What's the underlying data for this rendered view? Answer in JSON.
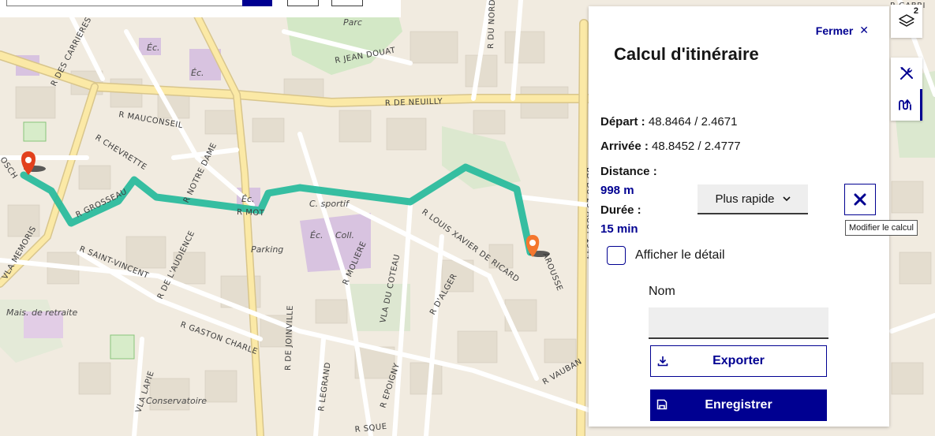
{
  "map": {
    "streets": [
      "R DES CARRIERES",
      "R JEAN DOUAT",
      "R DE NEUILLY",
      "R DU NORD",
      "R MAUCONSEIL",
      "R CHEVRETTE",
      "R NOTRE DAME",
      "R GROSSEAU",
      "R MOT",
      "R LOUIS XAVIER DE RICARD",
      "BD DU 25 AOUT 1944",
      "VLA MEMORIS",
      "R SAINT-VINCENT",
      "R DE L'AUDIENCE",
      "R MOLIERE",
      "VLA DU COTEAU",
      "R D'ALGER",
      "R GASTON CHARLE",
      "R DE JOINVILLE",
      "VLA LAPIE",
      "R LEGRAND",
      "R EPOIGNY",
      "R VAUBAN",
      "AROUSSE",
      "R SQUE",
      "R GABRI",
      "OSCH"
    ],
    "places": [
      "Parc",
      "Éc.",
      "Éc.",
      "Éc.",
      "C. sportif",
      "Éc.",
      "Coll.",
      "Parking",
      "Mais. de retraite",
      "Conservatoire"
    ],
    "route_color": "#21b99a",
    "start_marker_color": "#e2401c",
    "end_marker_color": "#f4772e"
  },
  "panel": {
    "close_label": "Fermer",
    "close_icon": "close-icon",
    "title": "Calcul d'itinéraire",
    "depart_label": "Départ :",
    "depart_value": "48.8464 / 2.4671",
    "arrivee_label": "Arrivée :",
    "arrivee_value": "48.8452 / 2.4777",
    "distance_label": "Distance :",
    "distance_value": "998 m",
    "duree_label": "Durée :",
    "duree_value": "15 min",
    "mode_selected": "Plus rapide",
    "clear_tooltip": "Modifier le calcul",
    "detail_label": "Afficher le détail",
    "name_label": "Nom",
    "name_value": "",
    "export_label": "Exporter",
    "save_label": "Enregistrer"
  },
  "controls": {
    "layers_badge": "2",
    "layers_icon": "layers-icon",
    "tools_icon": "tools-icon",
    "route_icon": "route-icon"
  },
  "colors": {
    "primary": "#000091",
    "panel_bg": "#ffffff",
    "field_bg": "#eeeeee"
  }
}
